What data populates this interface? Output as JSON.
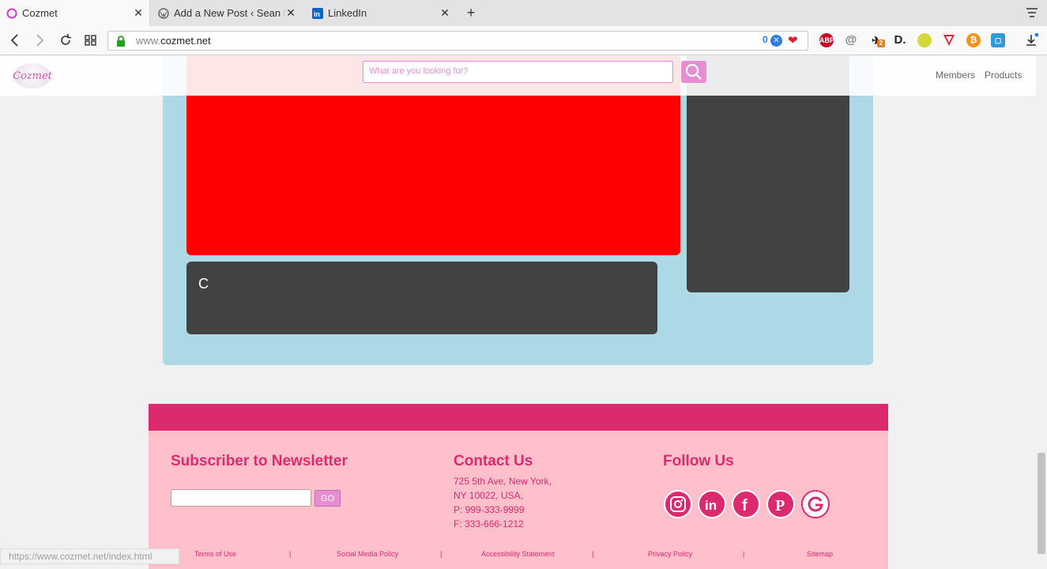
{
  "browser": {
    "tabs": [
      {
        "label": "Cozmet",
        "active": true
      },
      {
        "label": "Add a New Post ‹ Sean Ke",
        "active": false
      },
      {
        "label": "LinkedIn",
        "active": false
      }
    ],
    "url_prefix": "www.",
    "url_domain": "cozmet.net",
    "tracker_count": "0",
    "extensions": [
      {
        "name": "abp-icon",
        "text": "ABP",
        "color": "#c70d2c"
      },
      {
        "name": "at-icon",
        "text": "@",
        "color": "#777777"
      },
      {
        "name": "rocket-icon",
        "text": "2",
        "color": "#e67e22"
      },
      {
        "name": "d-icon",
        "text": "D.",
        "color": "#222222"
      },
      {
        "name": "wallet-icon",
        "text": "",
        "color": "#d4d93b"
      },
      {
        "name": "shield-icon",
        "text": "",
        "color": "#e0202e"
      },
      {
        "name": "bitcoin-icon",
        "text": "₿",
        "color": "#f7931a"
      },
      {
        "name": "box-icon",
        "text": "",
        "color": "#2e9bd9"
      }
    ],
    "status_url": "https://www.cozmet.net/index.html"
  },
  "site": {
    "logo_text": "Cozmet",
    "search_placeholder": "What are you looking for?",
    "nav": [
      "Members",
      "Products"
    ],
    "card_letter": "C"
  },
  "footer": {
    "newsletter_title": "Subscriber to Newsletter",
    "go_label": "GO",
    "contact_title": "Contact Us",
    "address_line1": "725 5th Ave, New York,",
    "address_line2": "NY 10022, USA,",
    "phone": "P: 999-333-9999",
    "fax": "F: 333-666-1212",
    "follow_title": "Follow Us",
    "social": [
      "instagram",
      "linkedin",
      "facebook",
      "pinterest",
      "google"
    ],
    "links": [
      "Terms of Use",
      "Social Media Policy",
      "Accessibility Statement",
      "Privacy Policy",
      "Sitemap"
    ],
    "separator": "|"
  },
  "colors": {
    "brand_pink": "#dc2a6e",
    "light_pink": "#ffc0cb",
    "accent_orchid": "#e58fd2",
    "panel_blue": "#add8e6",
    "red_box": "#ff0000",
    "dark_box": "#424242"
  }
}
